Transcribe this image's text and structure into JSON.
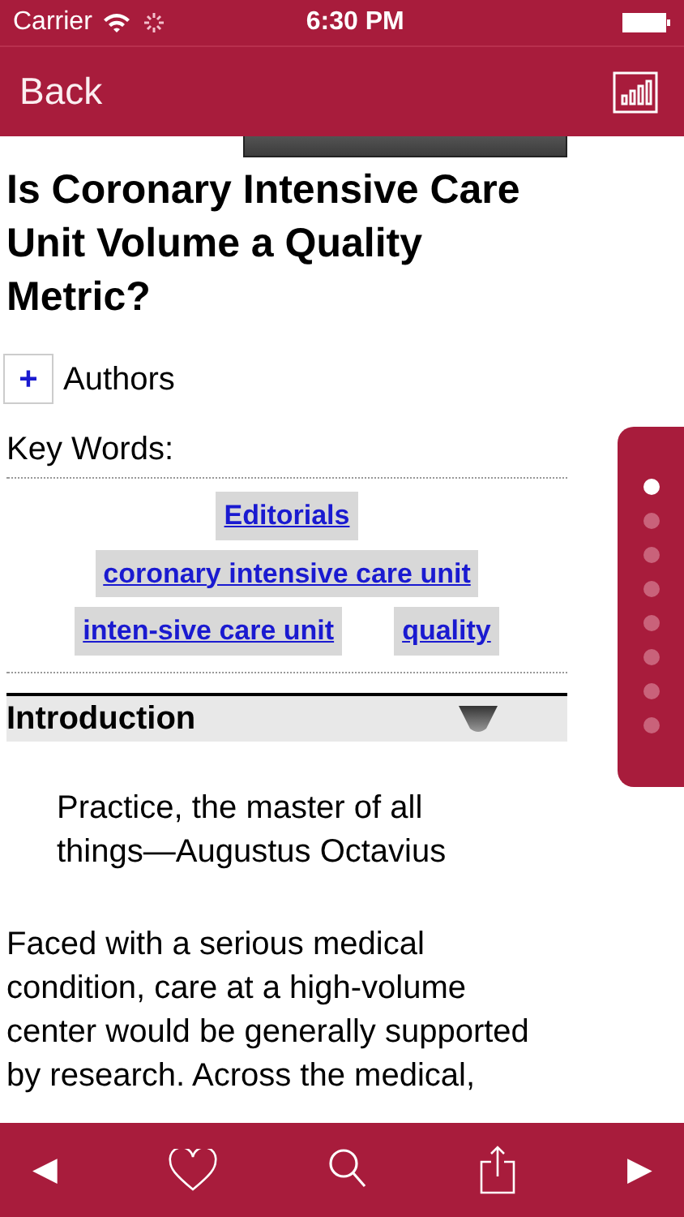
{
  "status_bar": {
    "carrier": "Carrier",
    "time": "6:30 PM"
  },
  "nav_bar": {
    "back": "Back"
  },
  "title": "Is Coronary Intensive Care Unit Volume a Quality Metric?",
  "authors": {
    "toggle": "+",
    "label": "Authors",
    "expanded": false
  },
  "key_words": {
    "label": "Key Words:",
    "tags": [
      "Editorials",
      "coronary intensive care unit",
      "inten-sive care unit",
      "quality"
    ]
  },
  "section": {
    "title": "Introduction",
    "expanded": true
  },
  "quote": "Practice, the master of all things—Augustus Octavius",
  "paragraph": "Faced with a serious medical condition, care at a high-volume center would be generally supported by research. Across the medical,",
  "page_indicator": [
    {
      "selected": true
    },
    {
      "selected": false
    },
    {
      "selected": false
    },
    {
      "selected": false
    },
    {
      "selected": false
    },
    {
      "selected": false
    },
    {
      "selected": false
    },
    {
      "selected": false
    }
  ],
  "toolbar": {
    "previous": "◀",
    "next": "▶"
  }
}
